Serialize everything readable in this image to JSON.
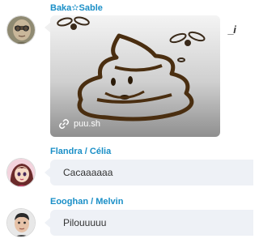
{
  "messages": [
    {
      "sender": "Baka✫Sable",
      "image": {
        "source_label": "puu.sh",
        "link_icon": "link-icon"
      },
      "status_mark": "_i"
    },
    {
      "sender": "Flandra / Célia",
      "text": "Cacaaaaaa"
    },
    {
      "sender": "Eooghan / Melvin",
      "text": "Pilouuuuu"
    }
  ],
  "colors": {
    "sender_name": "#1a8fc7",
    "bubble_background": "#eef1f6",
    "message_text": "#333333"
  }
}
